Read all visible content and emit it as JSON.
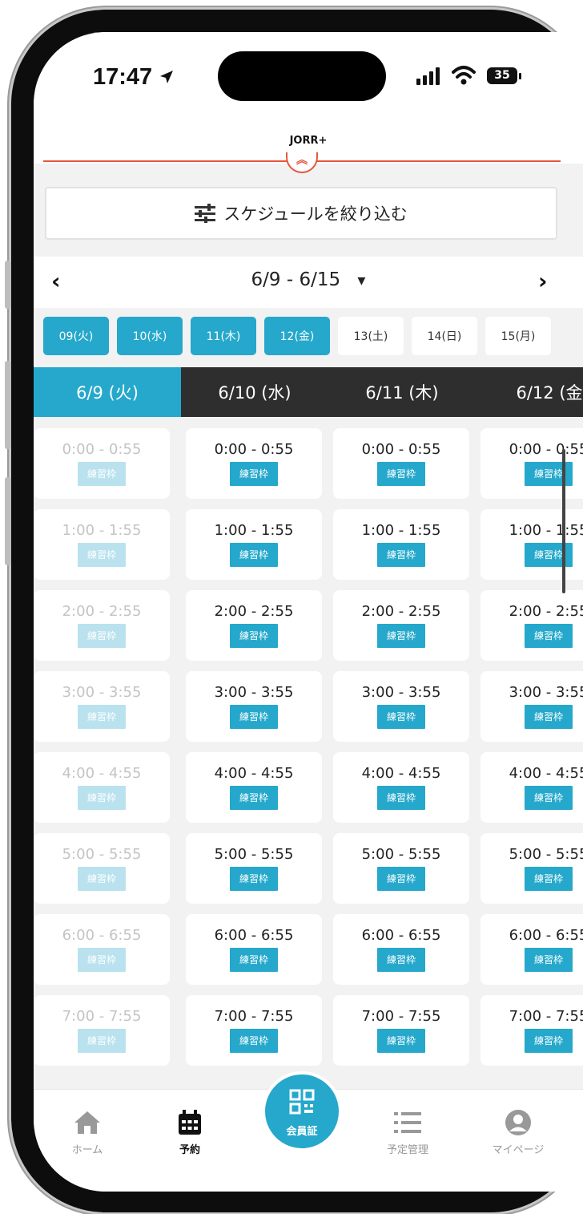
{
  "status_bar": {
    "time": "17:47",
    "battery": "35"
  },
  "app": {
    "title": "JORR+"
  },
  "filter": {
    "label": "スケジュールを絞り込む"
  },
  "week_nav": {
    "range": "6/9 - 6/15",
    "prev": "‹",
    "next": "›",
    "dropdown": "▾"
  },
  "day_pills": [
    {
      "label": "09(火)",
      "selected": true
    },
    {
      "label": "10(水)",
      "selected": true
    },
    {
      "label": "11(木)",
      "selected": true
    },
    {
      "label": "12(金)",
      "selected": true
    },
    {
      "label": "13(土)",
      "selected": false
    },
    {
      "label": "14(日)",
      "selected": false
    },
    {
      "label": "15(月)",
      "selected": false
    }
  ],
  "date_tabs": [
    "6/9 (火)",
    "6/10 (水)",
    "6/11 (木)",
    "6/12 (金"
  ],
  "slot_badge": "練習枠",
  "time_slots": [
    "0:00 - 0:55",
    "1:00 - 1:55",
    "2:00 - 2:55",
    "3:00 - 3:55",
    "4:00 - 4:55",
    "5:00 - 5:55",
    "6:00 - 6:55",
    "7:00 - 7:55"
  ],
  "bottom_nav": {
    "home": "ホーム",
    "reserve": "予約",
    "member_card": "会員証",
    "schedule": "予定管理",
    "mypage": "マイページ"
  },
  "colors": {
    "accent": "#25a8cb",
    "header_line": "#e4573d",
    "tab_bar": "#2e2e2e"
  }
}
